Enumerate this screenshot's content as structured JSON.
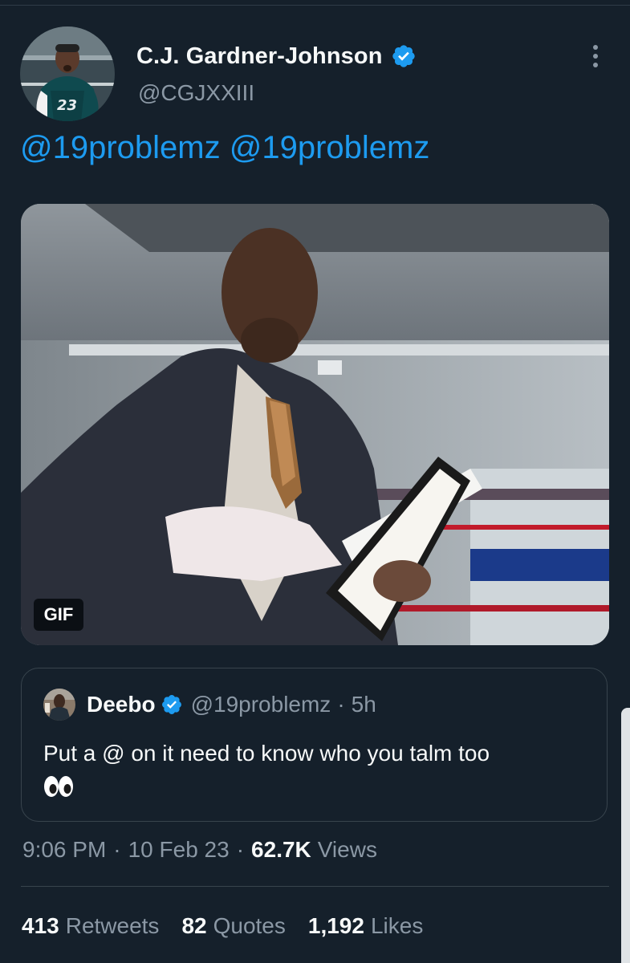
{
  "tweet": {
    "author": {
      "display_name": "C.J. Gardner-Johnson",
      "handle": "@CGJXXIII",
      "verified": true,
      "avatar_icon": "player-avatar-jersey-23"
    },
    "text_mentions": [
      "@19problemz",
      "@19problemz"
    ],
    "media": {
      "type": "gif",
      "badge": "GIF"
    },
    "quoted_tweet": {
      "display_name": "Deebo",
      "handle": "@19problemz",
      "separator": "·",
      "time_ago": "5h",
      "verified": true,
      "text": "Put a @ on it need to know who you talm too",
      "emoji_icon": "eyes-emoji"
    },
    "meta": {
      "time": "9:06 PM",
      "sep1": "·",
      "date": "10 Feb 23",
      "sep2": "·",
      "views_count": "62.7K",
      "views_label": "Views"
    },
    "stats": {
      "retweets_count": "413",
      "retweets_label": "Retweets",
      "quotes_count": "82",
      "quotes_label": "Quotes",
      "likes_count": "1,192",
      "likes_label": "Likes"
    }
  },
  "colors": {
    "background": "#15202b",
    "link": "#1d9bf0",
    "secondary_text": "#8b98a5",
    "primary_text": "#f7f9f9",
    "border": "#38444d",
    "verified": "#1d9bf0"
  }
}
